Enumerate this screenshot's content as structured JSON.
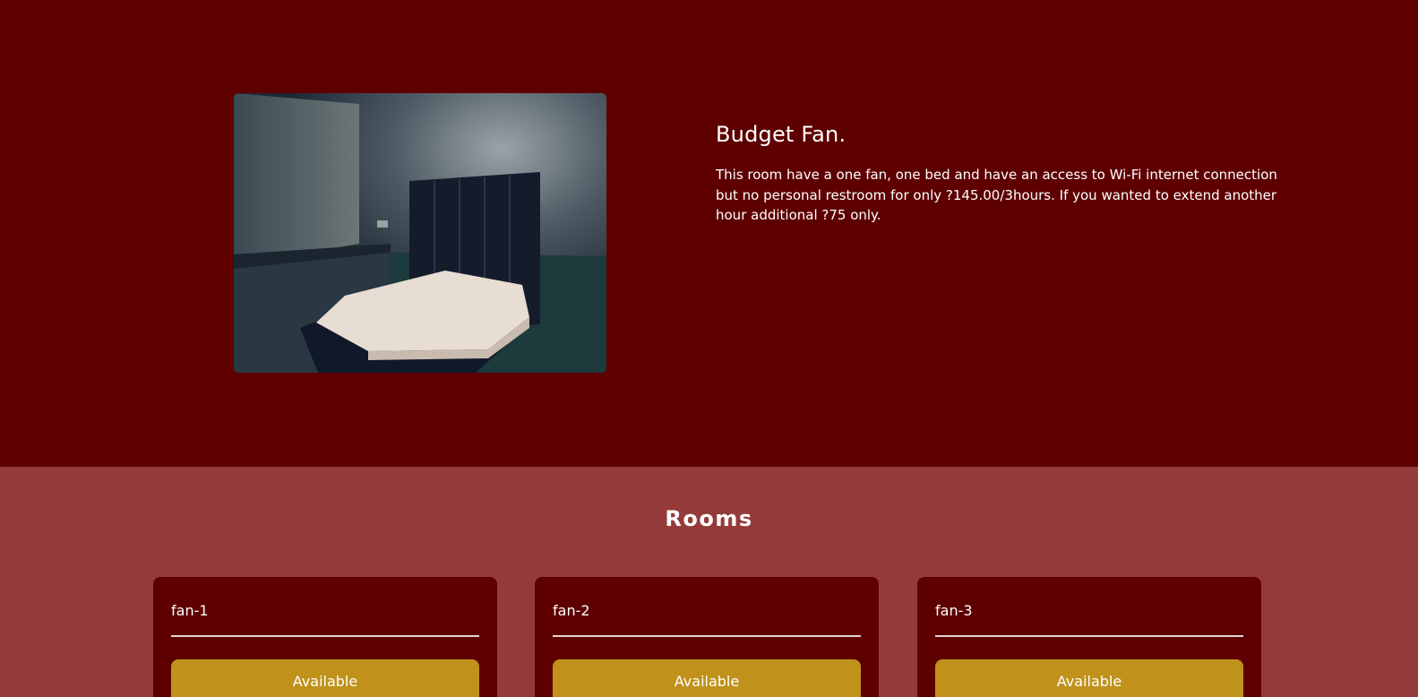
{
  "room": {
    "title": "Budget Fan.",
    "description": "This room have a one fan, one bed and have an access to Wi-Fi internet connection but no personal restroom for only ?145.00/3hours. If you wanted to extend another hour additional ?75 only."
  },
  "rooms_section": {
    "heading": "Rooms",
    "cards": [
      {
        "name": "fan-1",
        "status": "Available"
      },
      {
        "name": "fan-2",
        "status": "Available"
      },
      {
        "name": "fan-3",
        "status": "Available"
      }
    ]
  },
  "colors": {
    "hero_bg": "#5e0000",
    "section_bg": "#943a3a",
    "card_bg": "#5e0000",
    "available_button": "#c0921c"
  }
}
